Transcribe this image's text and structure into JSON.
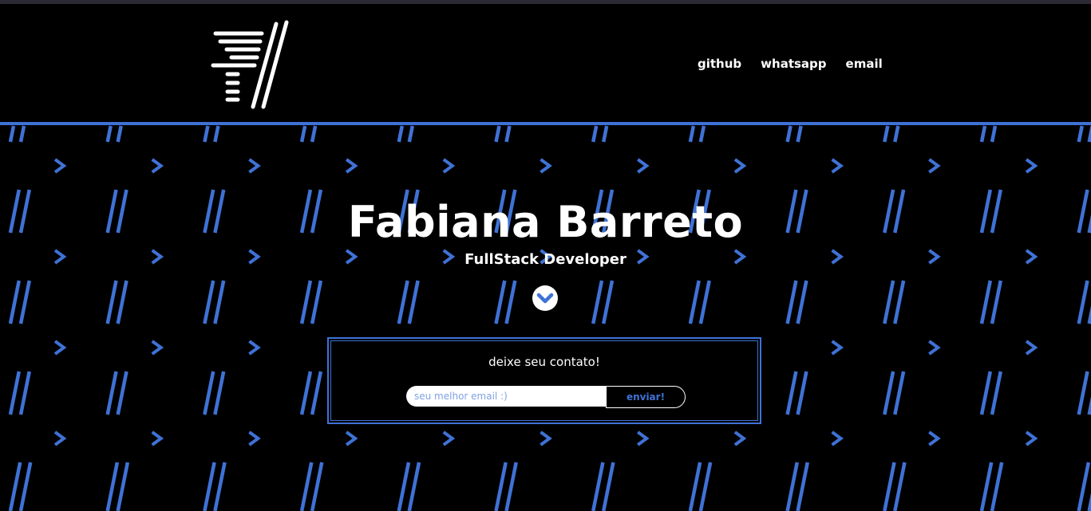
{
  "nav": {
    "items": [
      {
        "label": "github"
      },
      {
        "label": "whatsapp"
      },
      {
        "label": "email"
      }
    ]
  },
  "hero": {
    "title": "Fabiana Barreto",
    "subtitle": "FullStack Developer"
  },
  "contact": {
    "label": "deixe seu contato!",
    "email_placeholder": "seu melhor email :)",
    "send_label": "enviar!"
  },
  "colors": {
    "background": "#000000",
    "accent": "#3f72d6",
    "text": "#ffffff"
  },
  "icons": {
    "logo": "logo-mark",
    "scroll": "chevron-down-icon",
    "pattern_slash": "double-slash-icon",
    "pattern_arrow": "chevron-right-icon"
  }
}
